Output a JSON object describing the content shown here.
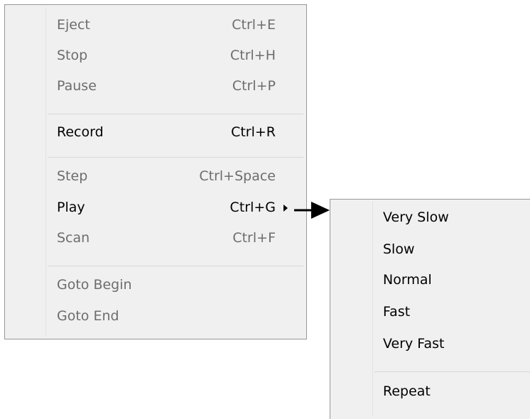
{
  "main_menu": {
    "items": [
      {
        "label": "Eject",
        "shortcut": "Ctrl+E",
        "state": "disabled"
      },
      {
        "label": "Stop",
        "shortcut": "Ctrl+H",
        "state": "disabled"
      },
      {
        "label": "Pause",
        "shortcut": "Ctrl+P",
        "state": "disabled"
      },
      {
        "label": "Record",
        "shortcut": "Ctrl+R",
        "state": "enabled"
      },
      {
        "label": "Step",
        "shortcut": "Ctrl+Space",
        "state": "disabled"
      },
      {
        "label": "Play",
        "shortcut": "Ctrl+G",
        "state": "enabled",
        "submenu_indicator": "submenu-arrow-icon"
      },
      {
        "label": "Scan",
        "shortcut": "Ctrl+F",
        "state": "disabled"
      },
      {
        "label": "Goto Begin",
        "shortcut": "",
        "state": "disabled"
      },
      {
        "label": "Goto End",
        "shortcut": "",
        "state": "disabled"
      }
    ]
  },
  "submenu": {
    "items": [
      {
        "label": "Very Slow",
        "state": "enabled"
      },
      {
        "label": "Slow",
        "state": "enabled"
      },
      {
        "label": "Normal",
        "state": "enabled"
      },
      {
        "label": "Fast",
        "state": "enabled"
      },
      {
        "label": "Very Fast",
        "state": "enabled"
      },
      {
        "label": "Repeat",
        "state": "enabled"
      }
    ]
  },
  "annotation": {
    "icon": "pointer-arrow-icon"
  },
  "colors": {
    "menu_background": "#f0f0f0",
    "disabled_text": "#6d6d6d",
    "enabled_text": "#000000",
    "border": "#979797"
  }
}
